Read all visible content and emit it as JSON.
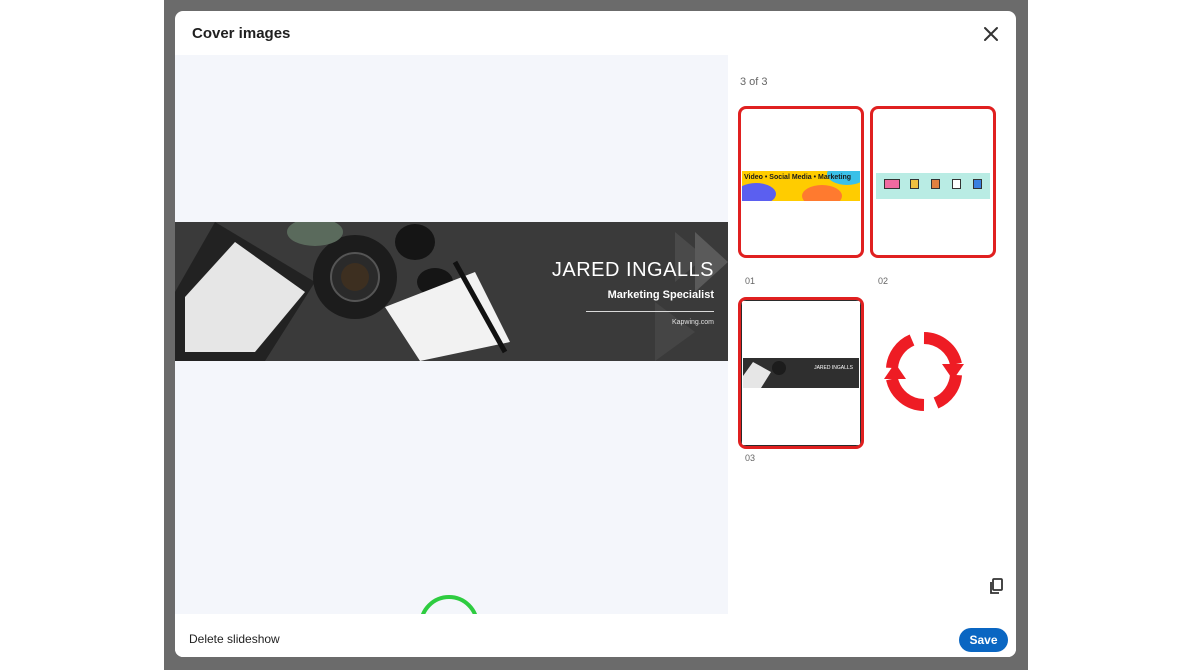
{
  "modal": {
    "title": "Cover images",
    "close_icon": "close-icon"
  },
  "preview": {
    "banner": {
      "name": "JARED INGALLS",
      "role": "Marketing Specialist",
      "site": "Kapwing.com"
    },
    "edit_icon": "pencil-icon",
    "edit_highlight_color": "#2ecc40"
  },
  "sidebar": {
    "count_text": "3 of 3",
    "highlight_color": "#e02020",
    "thumbnails": [
      {
        "label": "01",
        "caption": "Video • Social Media • Marketing"
      },
      {
        "label": "02"
      },
      {
        "label": "03",
        "caption": "JARED INGALLS"
      }
    ],
    "refresh_icon": "refresh-icon",
    "tools": [
      {
        "icon": "duplicate-icon"
      },
      {
        "icon": "trash-icon"
      },
      {
        "icon": "add-circle-icon"
      }
    ]
  },
  "footer": {
    "delete_label": "Delete slideshow",
    "save_label": "Save",
    "accent_color": "#0a66c2"
  }
}
